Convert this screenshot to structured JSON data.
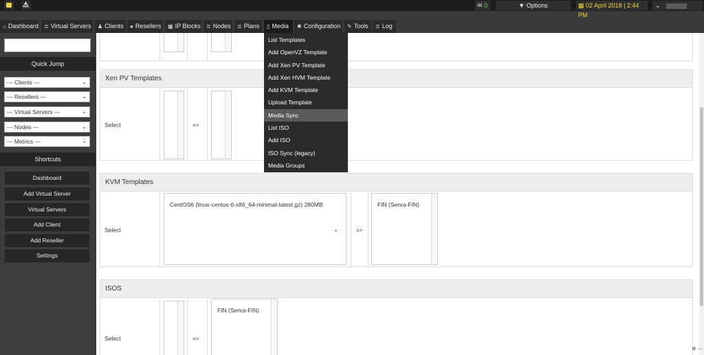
{
  "topbar": {
    "note_icon": "sticky-note-icon",
    "warn_icon": "warning-icon",
    "warn_glyph": "⚠",
    "mail_icon": "envelope-icon",
    "mail_glyph": "✉",
    "mail_count": "0",
    "options_label": "Options",
    "options_glyph": "▼",
    "date_glyph": "▦",
    "date_text": "02 April 2018 | 2:44 PM",
    "user_chevron": "⌄"
  },
  "nav": [
    {
      "name": "nav-dashboard",
      "icon": "home-icon",
      "glyph": "⌂",
      "label": "Dashboard"
    },
    {
      "name": "nav-virtual-servers",
      "icon": "list-icon",
      "glyph": "≣",
      "label": "Virtual Servers"
    },
    {
      "name": "nav-clients",
      "icon": "users-icon",
      "glyph": "♟",
      "label": "Clients"
    },
    {
      "name": "nav-resellers",
      "icon": "user-icon",
      "glyph": "●",
      "label": "Resellers"
    },
    {
      "name": "nav-ip-blocks",
      "icon": "grid-icon",
      "glyph": "▦",
      "label": "IP Blocks"
    },
    {
      "name": "nav-nodes",
      "icon": "list-icon",
      "glyph": "≣",
      "label": "Nodes"
    },
    {
      "name": "nav-plans",
      "icon": "list-icon",
      "glyph": "≣",
      "label": "Plans"
    },
    {
      "name": "nav-media",
      "icon": "file-icon",
      "glyph": "▯",
      "label": "Media"
    },
    {
      "name": "nav-configuration",
      "icon": "gear-icon",
      "glyph": "✱",
      "label": "Configuration"
    },
    {
      "name": "nav-tools",
      "icon": "wrench-icon",
      "glyph": "✎",
      "label": "Tools"
    },
    {
      "name": "nav-log",
      "icon": "list-icon",
      "glyph": "≣",
      "label": "Log"
    }
  ],
  "sidebar": {
    "quick_jump_value": "",
    "quick_jump_label": "Quick Jump",
    "selects": [
      "--- Clients ---",
      "--- Resellers ---",
      "--- Virtual Servers ---",
      "--- Nodes ---",
      "--- Metrics ---"
    ],
    "select_chevron": "⌄",
    "shortcuts_label": "Shortcuts",
    "shortcuts": [
      "Dashboard",
      "Add Virtual Server",
      "Virtual Servers",
      "Add Client",
      "Add Reseller",
      "Settings"
    ]
  },
  "main": {
    "xen_pv": {
      "title": "Xen PV Templates",
      "row_label": "Select",
      "arrow": "=>"
    },
    "kvm": {
      "title": "KVM Templates",
      "row_label": "Select",
      "arrow": "=>",
      "source_selected": "CentOS6 (linux-centos-6-x86_64-minimal-latest.gz) 280MB",
      "source_chevron": "⌄",
      "target_item": "FIN (Senra-FIN)"
    },
    "isos": {
      "title": "ISOS",
      "row_label": "Select",
      "arrow": "=>",
      "target_item": "FIN (Senra-FIN)"
    }
  },
  "media_menu": {
    "items": [
      "List Templates",
      "Add OpenVZ Template",
      "Add Xen PV Template",
      "Add Xen HVM Template",
      "Add KVM Template",
      "Upload Template",
      "Media Sync",
      "List ISO",
      "Add ISO",
      "ISO Sync (legacy)",
      "Media Groups"
    ],
    "highlighted": "Media Sync"
  },
  "corner_glyph": "⊕ ⇔"
}
